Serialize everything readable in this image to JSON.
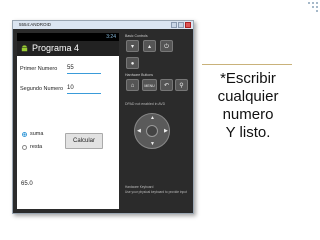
{
  "emulator": {
    "window_title": "5554:ANDROID",
    "status_time": "3:24",
    "app_title": "Programa 4",
    "fields": [
      {
        "label": "Primer Numero",
        "value": "55"
      },
      {
        "label": "Segundo Numero",
        "value": "10"
      }
    ],
    "radios": [
      {
        "label": "suma",
        "checked": true
      },
      {
        "label": "resta",
        "checked": false
      }
    ],
    "calc_button": "Calcular",
    "result": "65.0",
    "controls": {
      "basic_controls_label": "Basic Controls",
      "hardware_buttons_label": "Hardware Buttons",
      "dpad_note": "DPAD not enabled in AVD",
      "hw_keyboard_title": "Hardware Keyboard",
      "hw_keyboard_text": "Use your physical keyboard to provide input",
      "menu_label": "MENU"
    }
  },
  "caption": {
    "lines": [
      "*Escribir",
      "cualquier",
      "numero",
      "Y listo."
    ]
  },
  "colors": {
    "accent": "#3a9bd9",
    "actionbar": "#222222",
    "divider": "#c9b27a"
  }
}
